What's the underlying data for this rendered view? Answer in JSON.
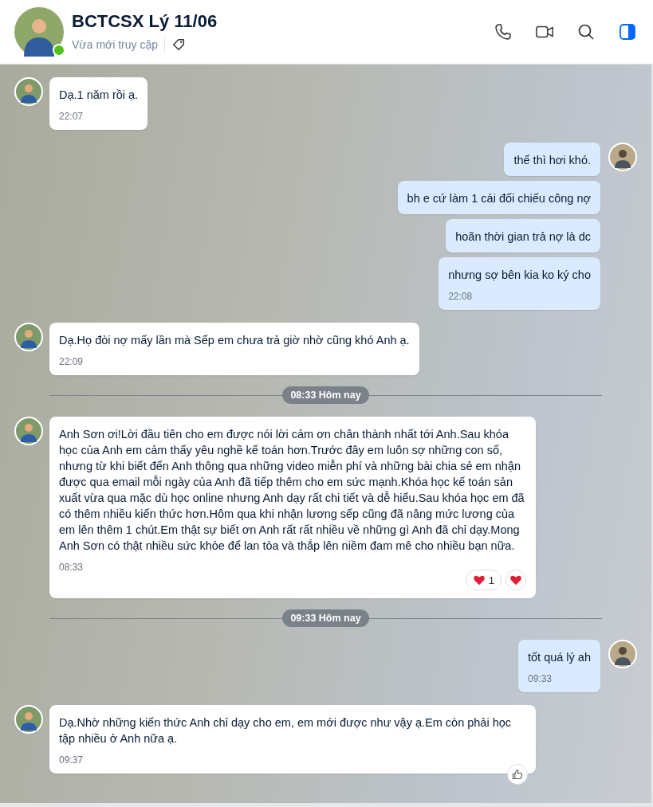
{
  "header": {
    "title": "BCTCSX Lý 11/06",
    "status": "Vừa mới truy cập",
    "online": true
  },
  "messages": [
    {
      "kind": "incoming",
      "text": "Dạ.1 năm rồi ạ.",
      "time": "22:07",
      "avatar": true
    },
    {
      "kind": "outgoing",
      "text": "thế thì hơi khó.",
      "avatar": true
    },
    {
      "kind": "outgoing",
      "text": "bh e cứ làm 1 cái đối chiếu công nợ",
      "avatar": false
    },
    {
      "kind": "outgoing",
      "text": "hoãn thời gian trả nợ là dc",
      "avatar": false
    },
    {
      "kind": "outgoing",
      "text": "nhưng sợ bên kia ko ký cho",
      "time": "22:08",
      "avatar": false
    },
    {
      "kind": "incoming",
      "text": "Dạ.Họ đòi nợ mấy lần mà Sếp em chưa trả giờ nhờ cũng khó Anh ạ.",
      "time": "22:09",
      "avatar": true
    },
    {
      "kind": "divider",
      "text": "08:33 Hôm nay"
    },
    {
      "kind": "incoming",
      "text": "Anh Sơn ơi!Lời đầu tiên cho em được nói lời cảm ơn chân thành nhất tới Anh.Sau khóa học của Anh em cảm thấy yêu nghề kế toán hơn.Trước đây em luôn sợ những con số, nhưng từ khi biết đến Anh thông qua những video miễn phí và những bài chia sẻ em nhận được qua email mỗi ngày của Anh đã tiếp thêm cho em sức mạnh.Khóa học kế toán sản xuất vừa qua mặc dù học online nhưng Anh dạy rất chi tiết và dễ hiểu.Sau khóa học em đã có thêm nhiều kiến thức hơn.Hôm qua khi nhận lương sếp cũng đã nâng mức lương của em lên thêm 1 chút.Em thật sự biết ơn Anh rất rất nhiều về những gì Anh đã chỉ dạy.Mong Anh Sơn có thật nhiều sức khỏe để lan tỏa và thắp lên niềm đam mê cho nhiều bạn nữa.",
      "time": "08:33",
      "avatar": true,
      "reaction": {
        "kind": "heart",
        "count": "1"
      }
    },
    {
      "kind": "divider",
      "text": "09:33 Hôm nay"
    },
    {
      "kind": "outgoing",
      "text": "tốt quá lý ah",
      "time": "09:33",
      "avatar": true
    },
    {
      "kind": "incoming",
      "text": "Dạ.Nhờ những kiến thức Anh chỉ dạy cho em, em mới được như vậy ạ.Em còn phải học tập nhiều ở Anh nữa ạ.",
      "time": "09:37",
      "avatar": true,
      "reaction": {
        "kind": "like"
      }
    }
  ]
}
